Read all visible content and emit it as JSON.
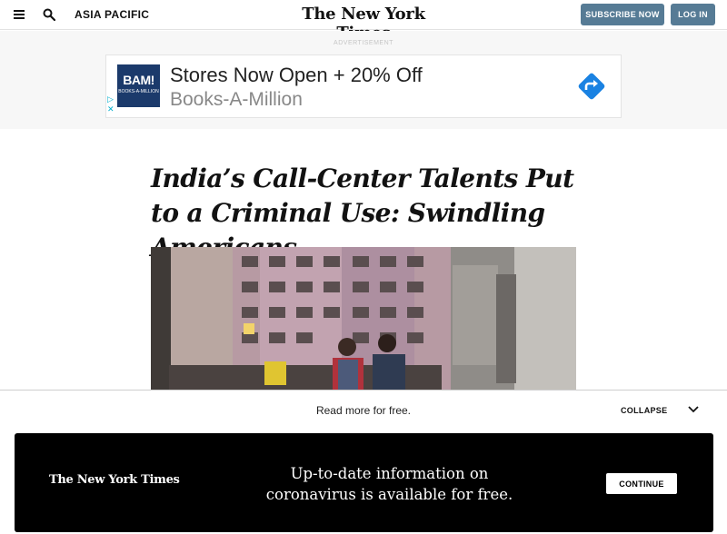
{
  "header": {
    "section": "ASIA PACIFIC",
    "logo": "The New York Times",
    "subscribe_label": "SUBSCRIBE NOW",
    "login_label": "LOG IN"
  },
  "ad": {
    "label": "ADVERTISEMENT",
    "brand_mark": "BAM!",
    "brand_mark_sub": "BOOKS-A-MILLION",
    "headline": "Stores Now Open + 20% Off",
    "advertiser": "Books-A-Million"
  },
  "article": {
    "headline": "India’s Call-Center Talents Put to a Criminal Use: Swindling Americans"
  },
  "read_more": {
    "text": "Read more for free.",
    "collapse_label": "COLLAPSE"
  },
  "banner": {
    "logo": "The New York Times",
    "message": "Up-to-date information on coronavirus is available for free.",
    "continue_label": "CONTINUE"
  },
  "colors": {
    "accent_button": "#567b95",
    "ad_arrow": "#1a82e2",
    "banner_bg": "#000000"
  }
}
